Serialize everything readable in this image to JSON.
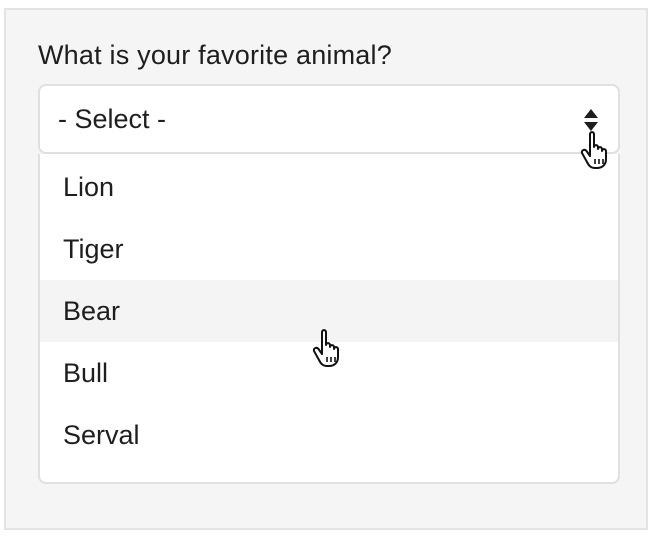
{
  "form": {
    "question": "What is your favorite animal?",
    "select": {
      "value": "- Select -",
      "icon": "sort-arrows-icon"
    },
    "options": [
      "Lion",
      "Tiger",
      "Bear",
      "Bull",
      "Serval"
    ],
    "hovered_option": "Bear"
  },
  "colors": {
    "panel_bg": "#f5f5f5",
    "border": "#e0e0e0",
    "hover_bg": "#f4f4f4",
    "text": "#1e1e1e"
  }
}
